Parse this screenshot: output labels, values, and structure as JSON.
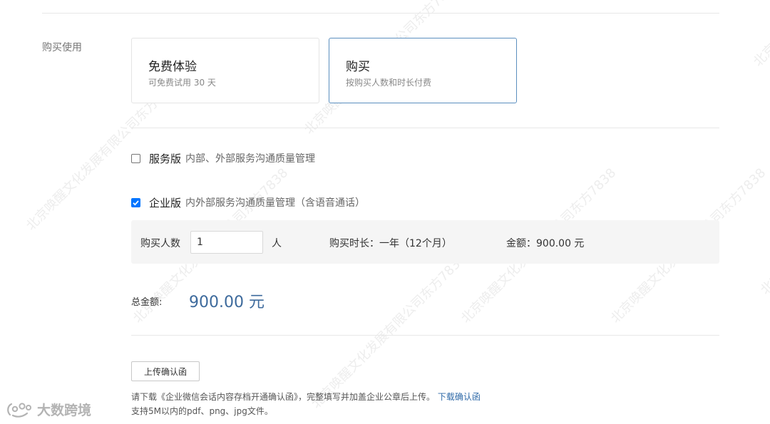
{
  "section": {
    "label": "购买使用"
  },
  "plans": [
    {
      "title": "免费体验",
      "description": "可免费试用 30 天",
      "selected": false
    },
    {
      "title": "购买",
      "description": "按购买人数和时长付费",
      "selected": true
    }
  ],
  "editions": [
    {
      "name": "服务版",
      "description": "内部、外部服务沟通质量管理",
      "checked": false
    },
    {
      "name": "企业版",
      "description": "内外部服务沟通质量管理（含语音通话）",
      "checked": true
    }
  ],
  "purchase": {
    "seats_label": "购买人数",
    "seats_value": "1",
    "seats_unit": "人",
    "duration_text": "购买时长：一年（12个月）",
    "amount_text": "金额：900.00 元"
  },
  "total": {
    "label": "总金额:",
    "value": "900.00 元"
  },
  "upload": {
    "button_label": "上传确认函",
    "note_prefix": "请下载《企业微信会话内容存档开通确认函》，完整填写并加盖企业公章后上传。",
    "note_link": "下载确认函",
    "note_formats": "支持5M以内的pdf、png、jpg文件。"
  },
  "watermark_text": "北京唤醒文化发展有限公司东方7838",
  "brand": {
    "name": "大数跨境",
    "icon": "brand-logo-icon"
  },
  "colors": {
    "accent": "#3d6a9c",
    "selected_border": "#5b8fbf",
    "link": "#2f6aa8",
    "checkbox_checked": "#0075ff"
  }
}
